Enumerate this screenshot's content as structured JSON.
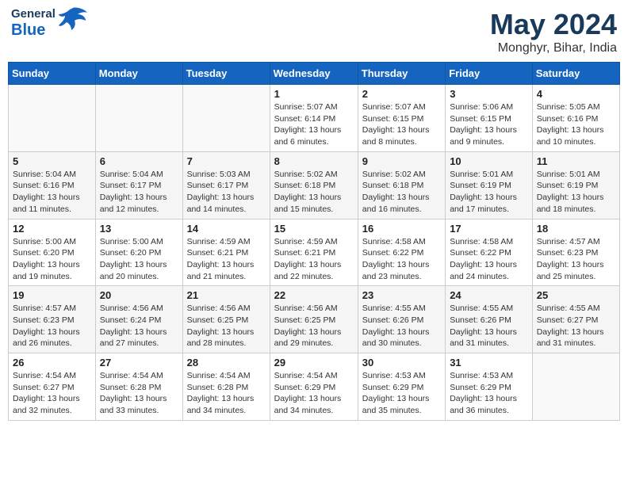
{
  "header": {
    "logo_general": "General",
    "logo_blue": "Blue",
    "month": "May 2024",
    "location": "Monghyr, Bihar, India"
  },
  "weekdays": [
    "Sunday",
    "Monday",
    "Tuesday",
    "Wednesday",
    "Thursday",
    "Friday",
    "Saturday"
  ],
  "weeks": [
    [
      {
        "num": "",
        "sunrise": "",
        "sunset": "",
        "daylight": ""
      },
      {
        "num": "",
        "sunrise": "",
        "sunset": "",
        "daylight": ""
      },
      {
        "num": "",
        "sunrise": "",
        "sunset": "",
        "daylight": ""
      },
      {
        "num": "1",
        "sunrise": "Sunrise: 5:07 AM",
        "sunset": "Sunset: 6:14 PM",
        "daylight": "Daylight: 13 hours and 6 minutes."
      },
      {
        "num": "2",
        "sunrise": "Sunrise: 5:07 AM",
        "sunset": "Sunset: 6:15 PM",
        "daylight": "Daylight: 13 hours and 8 minutes."
      },
      {
        "num": "3",
        "sunrise": "Sunrise: 5:06 AM",
        "sunset": "Sunset: 6:15 PM",
        "daylight": "Daylight: 13 hours and 9 minutes."
      },
      {
        "num": "4",
        "sunrise": "Sunrise: 5:05 AM",
        "sunset": "Sunset: 6:16 PM",
        "daylight": "Daylight: 13 hours and 10 minutes."
      }
    ],
    [
      {
        "num": "5",
        "sunrise": "Sunrise: 5:04 AM",
        "sunset": "Sunset: 6:16 PM",
        "daylight": "Daylight: 13 hours and 11 minutes."
      },
      {
        "num": "6",
        "sunrise": "Sunrise: 5:04 AM",
        "sunset": "Sunset: 6:17 PM",
        "daylight": "Daylight: 13 hours and 12 minutes."
      },
      {
        "num": "7",
        "sunrise": "Sunrise: 5:03 AM",
        "sunset": "Sunset: 6:17 PM",
        "daylight": "Daylight: 13 hours and 14 minutes."
      },
      {
        "num": "8",
        "sunrise": "Sunrise: 5:02 AM",
        "sunset": "Sunset: 6:18 PM",
        "daylight": "Daylight: 13 hours and 15 minutes."
      },
      {
        "num": "9",
        "sunrise": "Sunrise: 5:02 AM",
        "sunset": "Sunset: 6:18 PM",
        "daylight": "Daylight: 13 hours and 16 minutes."
      },
      {
        "num": "10",
        "sunrise": "Sunrise: 5:01 AM",
        "sunset": "Sunset: 6:19 PM",
        "daylight": "Daylight: 13 hours and 17 minutes."
      },
      {
        "num": "11",
        "sunrise": "Sunrise: 5:01 AM",
        "sunset": "Sunset: 6:19 PM",
        "daylight": "Daylight: 13 hours and 18 minutes."
      }
    ],
    [
      {
        "num": "12",
        "sunrise": "Sunrise: 5:00 AM",
        "sunset": "Sunset: 6:20 PM",
        "daylight": "Daylight: 13 hours and 19 minutes."
      },
      {
        "num": "13",
        "sunrise": "Sunrise: 5:00 AM",
        "sunset": "Sunset: 6:20 PM",
        "daylight": "Daylight: 13 hours and 20 minutes."
      },
      {
        "num": "14",
        "sunrise": "Sunrise: 4:59 AM",
        "sunset": "Sunset: 6:21 PM",
        "daylight": "Daylight: 13 hours and 21 minutes."
      },
      {
        "num": "15",
        "sunrise": "Sunrise: 4:59 AM",
        "sunset": "Sunset: 6:21 PM",
        "daylight": "Daylight: 13 hours and 22 minutes."
      },
      {
        "num": "16",
        "sunrise": "Sunrise: 4:58 AM",
        "sunset": "Sunset: 6:22 PM",
        "daylight": "Daylight: 13 hours and 23 minutes."
      },
      {
        "num": "17",
        "sunrise": "Sunrise: 4:58 AM",
        "sunset": "Sunset: 6:22 PM",
        "daylight": "Daylight: 13 hours and 24 minutes."
      },
      {
        "num": "18",
        "sunrise": "Sunrise: 4:57 AM",
        "sunset": "Sunset: 6:23 PM",
        "daylight": "Daylight: 13 hours and 25 minutes."
      }
    ],
    [
      {
        "num": "19",
        "sunrise": "Sunrise: 4:57 AM",
        "sunset": "Sunset: 6:23 PM",
        "daylight": "Daylight: 13 hours and 26 minutes."
      },
      {
        "num": "20",
        "sunrise": "Sunrise: 4:56 AM",
        "sunset": "Sunset: 6:24 PM",
        "daylight": "Daylight: 13 hours and 27 minutes."
      },
      {
        "num": "21",
        "sunrise": "Sunrise: 4:56 AM",
        "sunset": "Sunset: 6:25 PM",
        "daylight": "Daylight: 13 hours and 28 minutes."
      },
      {
        "num": "22",
        "sunrise": "Sunrise: 4:56 AM",
        "sunset": "Sunset: 6:25 PM",
        "daylight": "Daylight: 13 hours and 29 minutes."
      },
      {
        "num": "23",
        "sunrise": "Sunrise: 4:55 AM",
        "sunset": "Sunset: 6:26 PM",
        "daylight": "Daylight: 13 hours and 30 minutes."
      },
      {
        "num": "24",
        "sunrise": "Sunrise: 4:55 AM",
        "sunset": "Sunset: 6:26 PM",
        "daylight": "Daylight: 13 hours and 31 minutes."
      },
      {
        "num": "25",
        "sunrise": "Sunrise: 4:55 AM",
        "sunset": "Sunset: 6:27 PM",
        "daylight": "Daylight: 13 hours and 31 minutes."
      }
    ],
    [
      {
        "num": "26",
        "sunrise": "Sunrise: 4:54 AM",
        "sunset": "Sunset: 6:27 PM",
        "daylight": "Daylight: 13 hours and 32 minutes."
      },
      {
        "num": "27",
        "sunrise": "Sunrise: 4:54 AM",
        "sunset": "Sunset: 6:28 PM",
        "daylight": "Daylight: 13 hours and 33 minutes."
      },
      {
        "num": "28",
        "sunrise": "Sunrise: 4:54 AM",
        "sunset": "Sunset: 6:28 PM",
        "daylight": "Daylight: 13 hours and 34 minutes."
      },
      {
        "num": "29",
        "sunrise": "Sunrise: 4:54 AM",
        "sunset": "Sunset: 6:29 PM",
        "daylight": "Daylight: 13 hours and 34 minutes."
      },
      {
        "num": "30",
        "sunrise": "Sunrise: 4:53 AM",
        "sunset": "Sunset: 6:29 PM",
        "daylight": "Daylight: 13 hours and 35 minutes."
      },
      {
        "num": "31",
        "sunrise": "Sunrise: 4:53 AM",
        "sunset": "Sunset: 6:29 PM",
        "daylight": "Daylight: 13 hours and 36 minutes."
      },
      {
        "num": "",
        "sunrise": "",
        "sunset": "",
        "daylight": ""
      }
    ]
  ]
}
